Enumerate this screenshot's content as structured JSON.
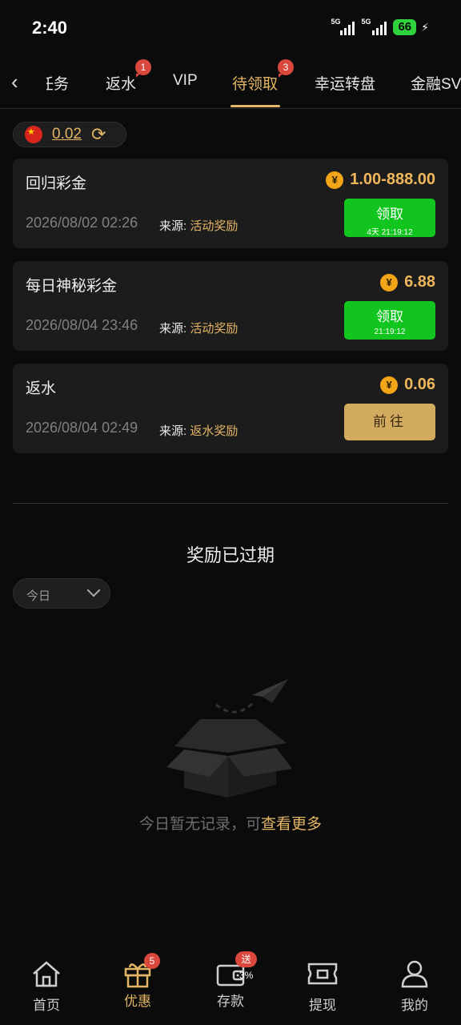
{
  "status_bar": {
    "time": "2:40",
    "signal1_label": "5G",
    "signal2_label": "5G",
    "battery": "66"
  },
  "tabs": {
    "items": [
      {
        "label": "任务",
        "display": "​务"
      },
      {
        "label": "返水",
        "badge": "1"
      },
      {
        "label": "VIP"
      },
      {
        "label": "待领取",
        "badge": "3",
        "active": true
      },
      {
        "label": "幸运转盘"
      },
      {
        "label": "金融SV"
      }
    ]
  },
  "balance": {
    "flag": "china-flag-icon",
    "value": "0.02"
  },
  "rewards": [
    {
      "title": "回归彩金",
      "amount": "1.00-888.00",
      "date": "2026/08/02 02:26",
      "source_label": "来源:",
      "source": "活动奖励",
      "button": "领取",
      "countdown": "4天 21:19:12"
    },
    {
      "title": "每日神秘彩金",
      "amount": "6.88",
      "date": "2026/08/04 23:46",
      "source_label": "来源:",
      "source": "活动奖励",
      "button": "领取",
      "countdown": "21:19:12"
    },
    {
      "title": "返水",
      "amount": "0.06",
      "date": "2026/08/04 02:49",
      "source_label": "来源:",
      "source": "返水奖励",
      "button": "前往"
    }
  ],
  "expired": {
    "title": "奖励已过期",
    "filter": "今日",
    "empty_text": "今日暂无记录，可",
    "empty_link": "查看更多"
  },
  "bottom_nav": [
    {
      "label": "首页",
      "icon": "home-icon"
    },
    {
      "label": "优惠",
      "icon": "gift-icon",
      "badge": "5",
      "active": true
    },
    {
      "label": "存款",
      "icon": "wallet-icon",
      "badge": "送3%"
    },
    {
      "label": "提现",
      "icon": "withdraw-icon"
    },
    {
      "label": "我的",
      "icon": "user-icon"
    }
  ],
  "colors": {
    "accent": "#e3b565",
    "claim_green": "#11c51e",
    "badge_red": "#d9473d"
  }
}
